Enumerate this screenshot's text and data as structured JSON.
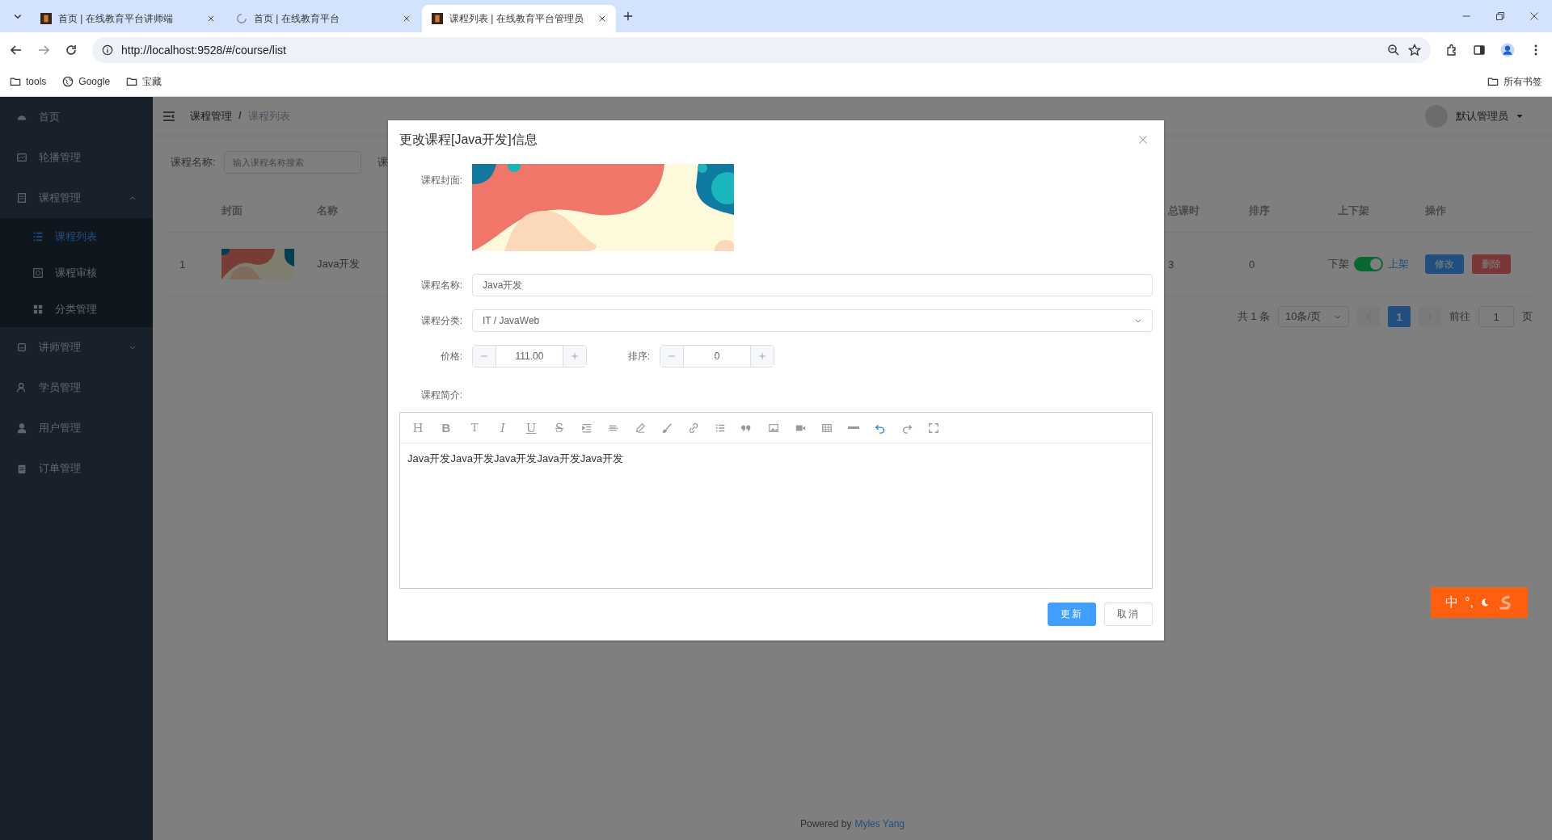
{
  "browser": {
    "tabs": [
      {
        "title": "首页 | 在线教育平台讲师端",
        "selected": false
      },
      {
        "title": "首页 | 在线教育平台",
        "selected": false
      },
      {
        "title": "课程列表 | 在线教育平台管理员",
        "selected": true
      }
    ],
    "url": "http://localhost:9528/#/course/list",
    "bookmarks": [
      "tools",
      "Google",
      "宝藏"
    ],
    "all_bookmarks": "所有书签"
  },
  "sidebar": {
    "items": [
      {
        "label": "首页",
        "kind": "item",
        "selected": false
      },
      {
        "label": "轮播管理",
        "kind": "item",
        "selected": false
      },
      {
        "label": "课程管理",
        "kind": "submenu",
        "expanded": true,
        "selected": false,
        "children": [
          {
            "label": "课程列表",
            "selected": true
          },
          {
            "label": "课程审核",
            "selected": false
          },
          {
            "label": "分类管理",
            "selected": false
          }
        ]
      },
      {
        "label": "讲师管理",
        "kind": "submenu",
        "expanded": false,
        "selected": false
      },
      {
        "label": "学员管理",
        "kind": "item",
        "selected": false
      },
      {
        "label": "用户管理",
        "kind": "item",
        "selected": false
      },
      {
        "label": "订单管理",
        "kind": "item",
        "selected": false
      }
    ]
  },
  "header": {
    "breadcrumb": [
      "课程管理",
      "课程列表"
    ],
    "separator": "/",
    "user": "默认管理员"
  },
  "filters": [
    {
      "label": "课程名称:",
      "placeholder": "输入课程名称搜索"
    },
    {
      "label": "课"
    }
  ],
  "table": {
    "columns": [
      "封面",
      "名称",
      "总课时",
      "排序",
      "上下架",
      "操作"
    ],
    "rows": [
      {
        "index": "1",
        "name": "Java开发",
        "hours": "3",
        "sort": "0",
        "off_label": "下架",
        "on": true,
        "on_label": "上架",
        "actions": [
          {
            "label": "修改",
            "kind": "edit"
          },
          {
            "label": "删除",
            "kind": "delete"
          }
        ]
      }
    ]
  },
  "pagination": {
    "total": "共 1 条",
    "page_size": "10条/页",
    "pages": [
      {
        "label": "1",
        "selected": true
      }
    ],
    "goto_label": "前往",
    "goto_value": "1",
    "goto_suffix": "页"
  },
  "dialog": {
    "title": "更改课程[Java开发]信息",
    "cover_label": "课程封面:",
    "name": {
      "label": "课程名称:",
      "value": "Java开发"
    },
    "category": {
      "label": "课程分类:",
      "value": "IT / JavaWeb"
    },
    "price": {
      "label": "价格:",
      "value": "111.00"
    },
    "sort": {
      "label": "排序:",
      "value": "0"
    },
    "intro": {
      "label": "课程简介:",
      "toolbar": [
        {
          "kind": "heading",
          "label": "H"
        },
        {
          "kind": "bold",
          "label": "B"
        },
        {
          "kind": "size",
          "label": "T"
        },
        {
          "kind": "italic",
          "label": "I"
        },
        {
          "kind": "underline",
          "label": "U"
        },
        {
          "kind": "strike",
          "label": "S"
        }
      ],
      "content": "Java开发Java开发Java开发Java开发Java开发"
    },
    "buttons": [
      {
        "label": "更新",
        "kind": "primary"
      },
      {
        "label": "取消",
        "kind": "default"
      }
    ]
  },
  "footer": {
    "text": "Powered by",
    "link": "Myles Yang"
  },
  "ime": {
    "label": "中",
    "punct": "°,"
  }
}
